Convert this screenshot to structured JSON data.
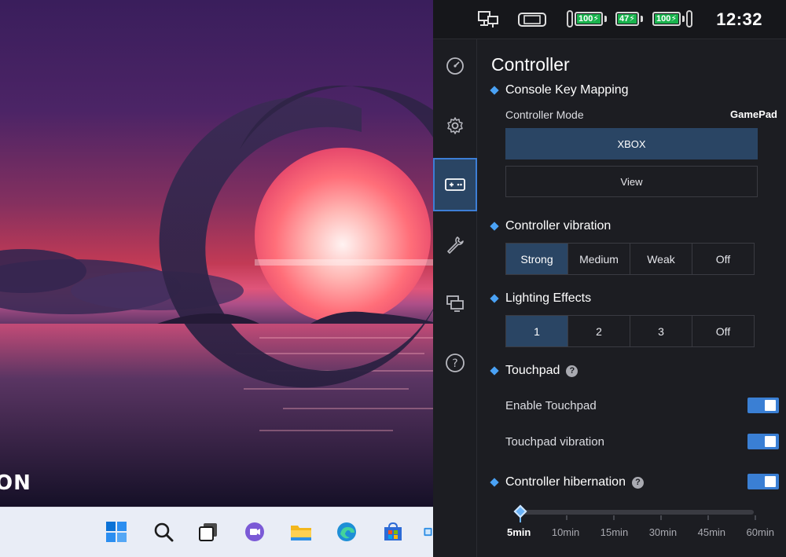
{
  "desktop": {
    "brand_text": "ON"
  },
  "taskbar": {
    "icons": [
      "windows-start-icon",
      "search-icon",
      "task-view-icon",
      "chat-icon",
      "file-explorer-icon",
      "edge-browser-icon",
      "microsoft-store-icon"
    ]
  },
  "status_bar": {
    "time": "12:32",
    "batteries": [
      {
        "name": "left-controller-battery",
        "level": "100"
      },
      {
        "name": "device-battery",
        "level": "47"
      },
      {
        "name": "right-controller-battery",
        "level": "100"
      }
    ]
  },
  "sidebar": {
    "items": [
      {
        "icon": "speedometer-icon",
        "active": false
      },
      {
        "icon": "gear-icon",
        "active": false
      },
      {
        "icon": "gamepad-icon",
        "active": true
      },
      {
        "icon": "wrench-icon",
        "active": false
      },
      {
        "icon": "display-icon",
        "active": false
      },
      {
        "icon": "help-circle-icon",
        "active": false
      }
    ]
  },
  "controller": {
    "title": "Controller",
    "key_mapping": {
      "title": "Console Key Mapping",
      "mode_label": "Controller Mode",
      "mode_value": "GamePad",
      "options": [
        "XBOX",
        "View"
      ],
      "selected": "XBOX"
    },
    "vibration": {
      "title": "Controller vibration",
      "options": [
        "Strong",
        "Medium",
        "Weak",
        "Off"
      ],
      "selected": "Strong"
    },
    "lighting": {
      "title": "Lighting Effects",
      "options": [
        "1",
        "2",
        "3",
        "Off"
      ],
      "selected": "1"
    },
    "touchpad": {
      "title": "Touchpad",
      "enable_label": "Enable Touchpad",
      "enable_on": true,
      "vibration_label": "Touchpad vibration",
      "vibration_on": true
    },
    "hibernation": {
      "title": "Controller hibernation",
      "on": true,
      "options": [
        "5min",
        "10min",
        "15min",
        "30min",
        "45min",
        "60min"
      ],
      "selected": "5min"
    }
  },
  "colors": {
    "accent": "#3a7fd4",
    "selected_bg": "#2a4564",
    "panel_bg": "#1c1d22",
    "battery_green": "#19b24d"
  }
}
